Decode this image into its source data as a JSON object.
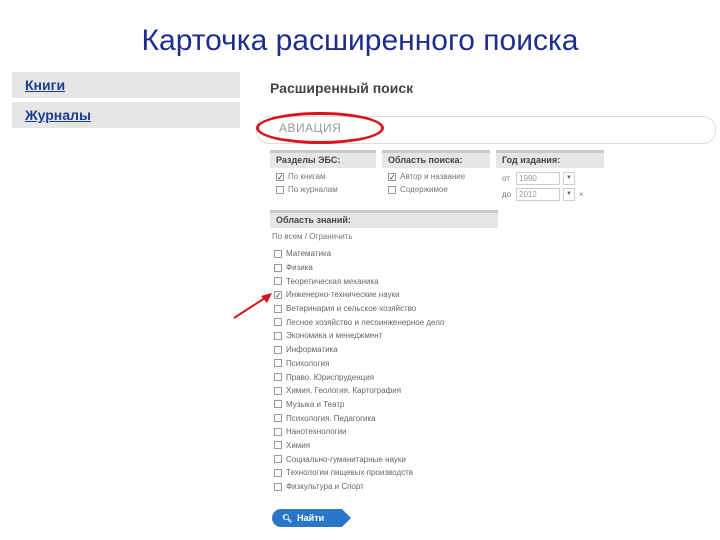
{
  "slide_title": "Карточка расширенного поиска",
  "sidebar": {
    "items": [
      {
        "label": "Книги"
      },
      {
        "label": "Журналы"
      }
    ]
  },
  "main": {
    "title": "Расширенный поиск",
    "search": {
      "value": "АВИАЦИЯ"
    },
    "sections_panel": {
      "title": "Разделы ЭБС:",
      "options": [
        {
          "label": "По книгам",
          "checked": true
        },
        {
          "label": "По журналам",
          "checked": false
        }
      ]
    },
    "scope_panel": {
      "title": "Область поиска:",
      "options": [
        {
          "label": "Автор и название",
          "checked": true
        },
        {
          "label": "Содержимое",
          "checked": false
        }
      ]
    },
    "year_panel": {
      "title": "Год издания:",
      "from_label": "от",
      "from_value": "1990",
      "to_label": "до",
      "to_value": "2012"
    },
    "areas_panel": {
      "title": "Область знаний:",
      "sublabel": "По всем / Ограничить",
      "items": [
        {
          "label": "Математика",
          "checked": false
        },
        {
          "label": "Физика",
          "checked": false
        },
        {
          "label": "Теоретическая механика",
          "checked": false
        },
        {
          "label": "Инженерно-технические науки",
          "checked": true
        },
        {
          "label": "Ветеринария и сельское хозяйство",
          "checked": false
        },
        {
          "label": "Лесное хозяйство и лесоинженерное дело",
          "checked": false
        },
        {
          "label": "Экономика и менеджмент",
          "checked": false
        },
        {
          "label": "Информатика",
          "checked": false
        },
        {
          "label": "Психология",
          "checked": false
        },
        {
          "label": "Право. Юриспруденция",
          "checked": false
        },
        {
          "label": "Химия. Геология. Картография",
          "checked": false
        },
        {
          "label": "Музыка и Театр",
          "checked": false
        },
        {
          "label": "Психология. Педагогика",
          "checked": false
        },
        {
          "label": "Нанотехнологии",
          "checked": false
        },
        {
          "label": "Химия",
          "checked": false
        },
        {
          "label": "Социально-гуманитарные науки",
          "checked": false
        },
        {
          "label": "Технологии пищевых производств",
          "checked": false
        },
        {
          "label": "Физкультура и Спорт",
          "checked": false
        }
      ]
    },
    "find_button": "Найти"
  },
  "colors": {
    "title": "#1f2d8c",
    "link": "#1b3d8f",
    "accent": "#2a77c9",
    "highlight": "#d8141a"
  }
}
